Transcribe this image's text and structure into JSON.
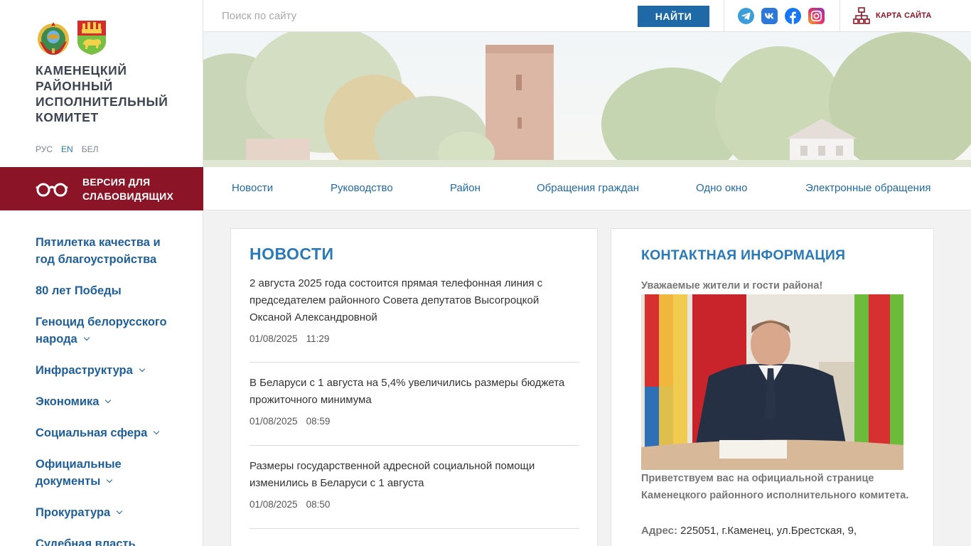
{
  "org": {
    "name": "КАМЕНЕЦКИЙ РАЙОННЫЙ ИСПОЛНИТЕЛЬНЫЙ КОМИТЕТ"
  },
  "languages": [
    "РУС",
    "EN",
    "БЕЛ"
  ],
  "accessibility": {
    "label": "ВЕРСИЯ ДЛЯ СЛАБОВИДЯЩИХ"
  },
  "sidebar": {
    "items": [
      {
        "label": "Пятилетка качества и год благоустройства"
      },
      {
        "label": "80 лет Победы"
      },
      {
        "label": "Геноцид белорусского народа"
      },
      {
        "label": "Инфраструктура"
      },
      {
        "label": "Экономика"
      },
      {
        "label": "Социальная сфера"
      },
      {
        "label": "Официальные документы"
      },
      {
        "label": "Прокуратура"
      },
      {
        "label": "Судебная власть"
      }
    ]
  },
  "search": {
    "placeholder": "Поиск по сайту",
    "button": "НАЙТИ"
  },
  "socials": [
    "telegram-icon",
    "vk-icon",
    "facebook-icon",
    "instagram-icon"
  ],
  "sitemap": {
    "label": "КАРТА САЙТА"
  },
  "nav": [
    "Новости",
    "Руководство",
    "Район",
    "Обращения граждан",
    "Одно окно",
    "Электронные обращения"
  ],
  "news": {
    "title": "НОВОСТИ",
    "items": [
      {
        "title": "2 августа 2025 года состоится прямая телефонная линия с председателем районного Совета депутатов Высогроцкой Оксаной Александровной",
        "date": "01/08/2025",
        "time": "11:29"
      },
      {
        "title": "В Беларуси с 1 августа на 5,4% увеличились размеры бюджета прожиточного минимума",
        "date": "01/08/2025",
        "time": "08:59"
      },
      {
        "title": "Размеры государственной адресной социальной помощи изменились в Беларуси с 1 августа",
        "date": "01/08/2025",
        "time": "08:50"
      }
    ]
  },
  "contact": {
    "title": "КОНТАКТНАЯ ИНФОРМАЦИЯ",
    "greeting": "Уважаемые жители и гости района!",
    "welcome": "Приветствуем вас на официальной странице Каменецкого районного исполнительного комитета.",
    "address_label": "Адрес:",
    "address": "225051, г.Каменец, ул.Брестская, 9,"
  },
  "colors": {
    "accent_blue": "#1f6aa6",
    "heading_blue": "#2a7ab8",
    "brand_red": "#8b1526"
  }
}
